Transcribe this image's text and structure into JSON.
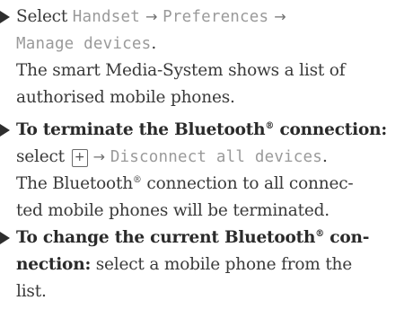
{
  "step1": {
    "verb": "Select",
    "path": [
      "Handset",
      "Preferences",
      "Manage devices"
    ],
    "arrow": "→",
    "end": ".",
    "result_line1": "The smart Media-System shows a list of",
    "result_line2": "authorised mobile phones."
  },
  "step2": {
    "heading_part1": "To terminate the Bluetooth",
    "reg": "®",
    "heading_part2": " connection:",
    "verb": "select",
    "plus_icon": "plus-key-icon",
    "plus_symbol": "+",
    "arrow": "→",
    "menu_item": "Disconnect all devices",
    "end": ".",
    "result_part1": "The Bluetooth",
    "result_part2": " connection to all connec-",
    "result_line2": "ted mobile phones will be terminated."
  },
  "step3": {
    "heading_part1": "To change the current Bluetooth",
    "reg": "®",
    "heading_part2": " con-",
    "heading_line2": "nection:",
    "text_line2": " select a mobile phone from the",
    "text_line3": "list."
  }
}
